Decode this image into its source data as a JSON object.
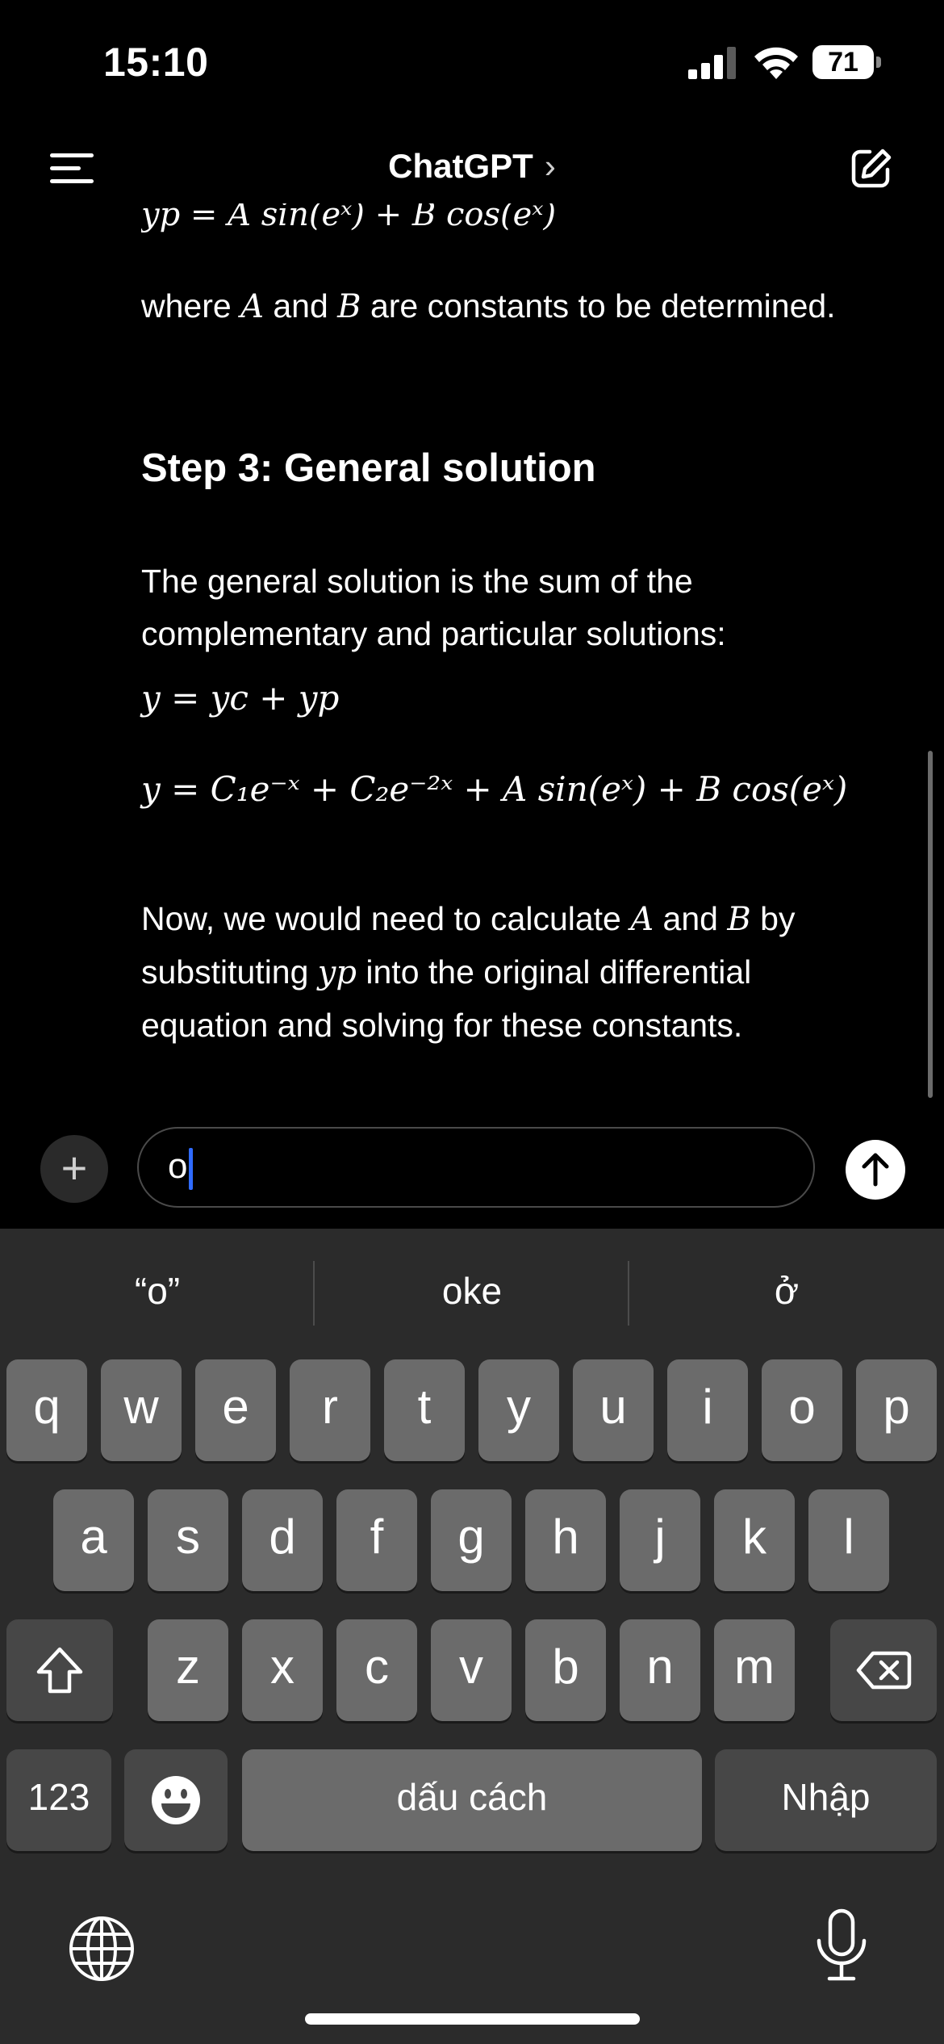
{
  "status_bar": {
    "time": "15:10",
    "battery": "71"
  },
  "header": {
    "title": "ChatGPT",
    "chevron": "›",
    "menu_icon": "menu-icon",
    "compose_icon": "compose-icon"
  },
  "content": {
    "partial_equation": "yp = A sin(eˣ) + B cos(eˣ)",
    "para1_prefix": "where ",
    "para1_var_a": "A",
    "para1_mid": " and ",
    "para1_var_b": "B",
    "para1_suffix": " are constants to be determined.",
    "heading": "Step 3: General solution",
    "para2": "The general solution is the sum of the complementary and particular solutions:",
    "eq1": "y = yc + yp",
    "eq2": "y = C₁e⁻ˣ + C₂e⁻²ˣ + A sin(eˣ) + B cos(eˣ)",
    "para3_prefix": "Now, we would need to calculate ",
    "para3_var_a": "A",
    "para3_mid1": " and ",
    "para3_var_b": "B",
    "para3_mid2": " by substituting ",
    "para3_var_yp": "yp",
    "para3_suffix": " into the original differential equation and solving for these constants."
  },
  "composer": {
    "plus_label": "+",
    "input_value": "o",
    "send_icon": "arrow-up-icon"
  },
  "keyboard": {
    "suggestions": [
      "“o”",
      "oke",
      "ở"
    ],
    "row1": [
      "q",
      "w",
      "e",
      "r",
      "t",
      "y",
      "u",
      "i",
      "o",
      "p"
    ],
    "row2": [
      "a",
      "s",
      "d",
      "f",
      "g",
      "h",
      "j",
      "k",
      "l"
    ],
    "row3": [
      "z",
      "x",
      "c",
      "v",
      "b",
      "n",
      "m"
    ],
    "numbers_key": "123",
    "space_key": "dấu cách",
    "return_key": "Nhập",
    "shift_icon": "shift-icon",
    "delete_icon": "delete-icon",
    "emoji_icon": "emoji-icon",
    "globe_icon": "globe-icon",
    "mic_icon": "microphone-icon"
  }
}
